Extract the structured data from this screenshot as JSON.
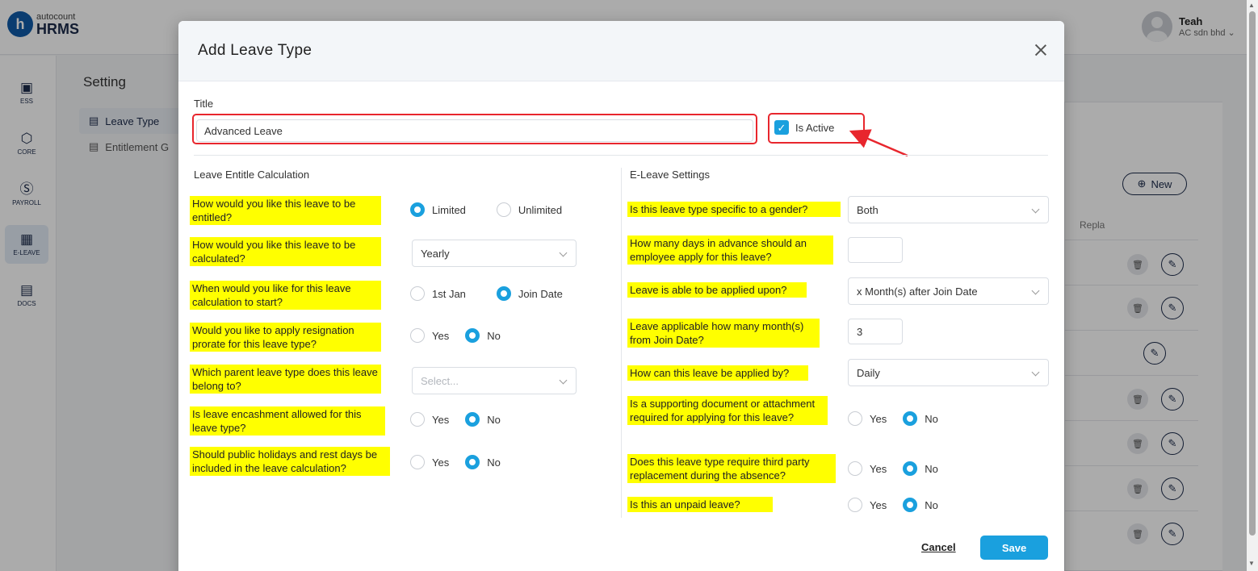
{
  "app": {
    "logo_top": "autocount",
    "logo_bottom": "HRMS",
    "logo_mark": "h"
  },
  "user": {
    "name": "Teah",
    "company": "AC sdn bhd"
  },
  "sidenav": [
    {
      "label": "ESS",
      "icon": "ess-icon"
    },
    {
      "label": "CORE",
      "icon": "core-icon"
    },
    {
      "label": "PAYROLL",
      "icon": "payroll-icon"
    },
    {
      "label": "E-LEAVE",
      "icon": "calendar-icon",
      "active": true
    },
    {
      "label": "DOCS",
      "icon": "docs-icon"
    }
  ],
  "setting": {
    "title": "Setting",
    "menu": [
      {
        "label": "Leave Type",
        "active": true
      },
      {
        "label": "Entitlement G"
      }
    ]
  },
  "background_table": {
    "new_label": "New",
    "column": "Repla"
  },
  "modal": {
    "title": "Add Leave Type",
    "title_label": "Title",
    "title_value": "Advanced Leave",
    "is_active_label": "Is Active",
    "is_active": true,
    "left_section_title": "Leave Entitle Calculation",
    "right_section_title": "E-Leave Settings",
    "left_questions": [
      "How would you like this leave to be entitled?",
      "How would you like this leave to be calculated?",
      "When would you like for this leave calculation to start?",
      "Would you like to apply resignation prorate for this leave type?",
      "Which parent leave type does this leave belong to?",
      "Is leave encashment allowed for this leave type?",
      "Should public holidays and rest days be included in the leave calculation?"
    ],
    "right_questions": [
      "Is this leave type specific to a gender?",
      "How many days in advance should an employee apply for this leave?",
      "Leave is able to be applied upon?",
      "Leave applicable how many month(s) from Join Date?",
      "How can this leave be applied by?",
      "Is a supporting document or attachment required for applying for this leave?",
      "Does this leave type require third party replacement during the absence?",
      "Is this an unpaid leave?"
    ],
    "options": {
      "limited": "Limited",
      "unlimited": "Unlimited",
      "jan1": "1st Jan",
      "join_date": "Join Date",
      "yes": "Yes",
      "no": "No"
    },
    "calculated_value": "Yearly",
    "parent_placeholder": "Select...",
    "gender_value": "Both",
    "advance_days_value": "",
    "applied_upon_value": "x Month(s) after Join Date",
    "months_value": "3",
    "applied_by_value": "Daily",
    "cancel_label": "Cancel",
    "save_label": "Save"
  },
  "colors": {
    "accent": "#1aa0de",
    "highlight": "#ffff00",
    "annotation": "#e8262d",
    "brand": "#0f5aa8"
  }
}
